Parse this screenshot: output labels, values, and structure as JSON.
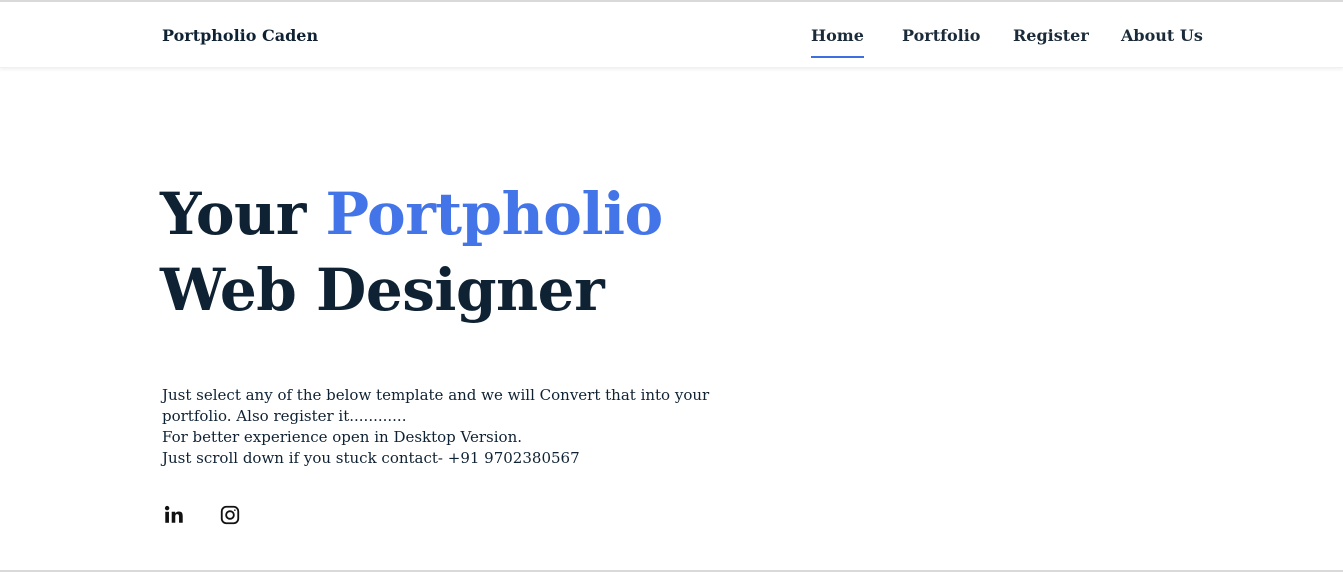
{
  "header": {
    "brand": "Portpholio Caden",
    "nav": [
      {
        "label": "Home",
        "active": true
      },
      {
        "label": "Portfolio",
        "active": false
      },
      {
        "label": "Register",
        "active": false
      },
      {
        "label": "About Us",
        "active": false
      }
    ]
  },
  "hero": {
    "title_prefix": "Your ",
    "title_accent": "Portpholio",
    "title_line2": "Web Designer"
  },
  "description": {
    "line1": "Just select any of the below template and we will Convert that into your",
    "line2": "portfolio. Also register it............",
    "line3": "For better experience open in Desktop Version.",
    "line4": "Just scroll down if you stuck contact- +91 9702380567"
  },
  "social": [
    {
      "icon": "linkedin-icon"
    },
    {
      "icon": "instagram-icon"
    }
  ],
  "colors": {
    "accent": "#4475e8",
    "text": "#0f2233",
    "underline": "#3d6fe0"
  }
}
